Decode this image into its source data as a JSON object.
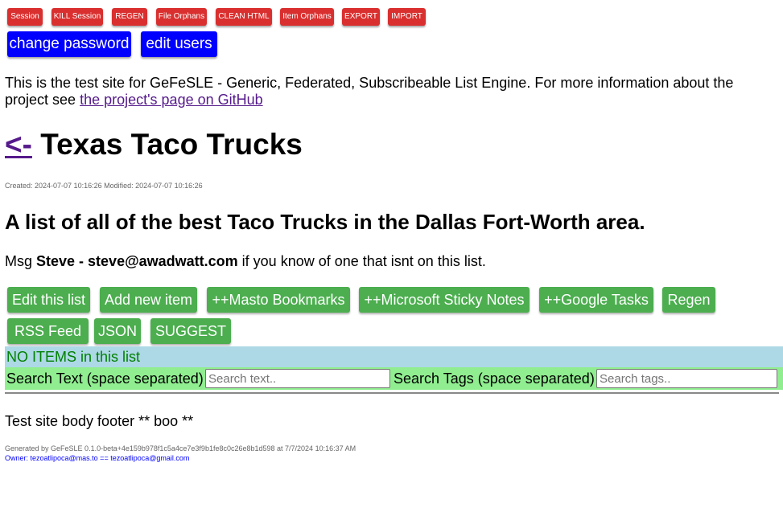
{
  "admin_buttons": [
    "Session",
    "KILL Session",
    "REGEN",
    "File Orphans",
    "CLEAN HTML",
    "Item Orphans",
    "EXPORT",
    "IMPORT"
  ],
  "user_buttons": [
    "change password",
    "edit users"
  ],
  "intro": {
    "text": "This is the test site for GeFeSLE - Generic, Federated, Subscribeable List Engine. For more information about the project see ",
    "link_text": "the project's page on GitHub"
  },
  "list": {
    "back_link": "<-",
    "title": "Texas Taco Trucks",
    "meta": "Created: 2024-07-07 10:16:26 Modified: 2024-07-07 10:16:26",
    "description": "A list of all of the best Taco Trucks in the Dallas Fort-Worth area.",
    "msg_prefix": "Msg ",
    "msg_bold": "Steve - steve@awadwatt.com",
    "msg_suffix": " if you know of one that isnt on this list."
  },
  "action_buttons": [
    "Edit this list",
    "Add new item",
    "++Masto Bookmarks",
    "++Microsoft Sticky Notes",
    "++Google Tasks",
    "Regen",
    "RSS Feed",
    "JSON",
    "SUGGEST"
  ],
  "no_items": "NO ITEMS in this list",
  "search": {
    "text_label": "Search Text (space separated)",
    "text_placeholder": "Search text..",
    "tags_label": "Search Tags (space separated)",
    "tags_placeholder": "Search tags.."
  },
  "footer": {
    "body_text": "Test site body footer ** boo **",
    "generated": "Generated by GeFeSLE 0.1.0-beta+4e159b978f1c5a4ce7e3f9b1fe8c0c26e8b1d598 at 7/7/2024 10:16:37 AM",
    "owner": "Owner: tezoatlipoca@mas.to == tezoatlipoca@gmail.com"
  },
  "colors": {
    "admin_button": "#d9302f",
    "user_button": "#0000ff",
    "action_button": "#4cae4f",
    "no_items_bg": "#add8e6",
    "search_bg": "#90ee90"
  }
}
